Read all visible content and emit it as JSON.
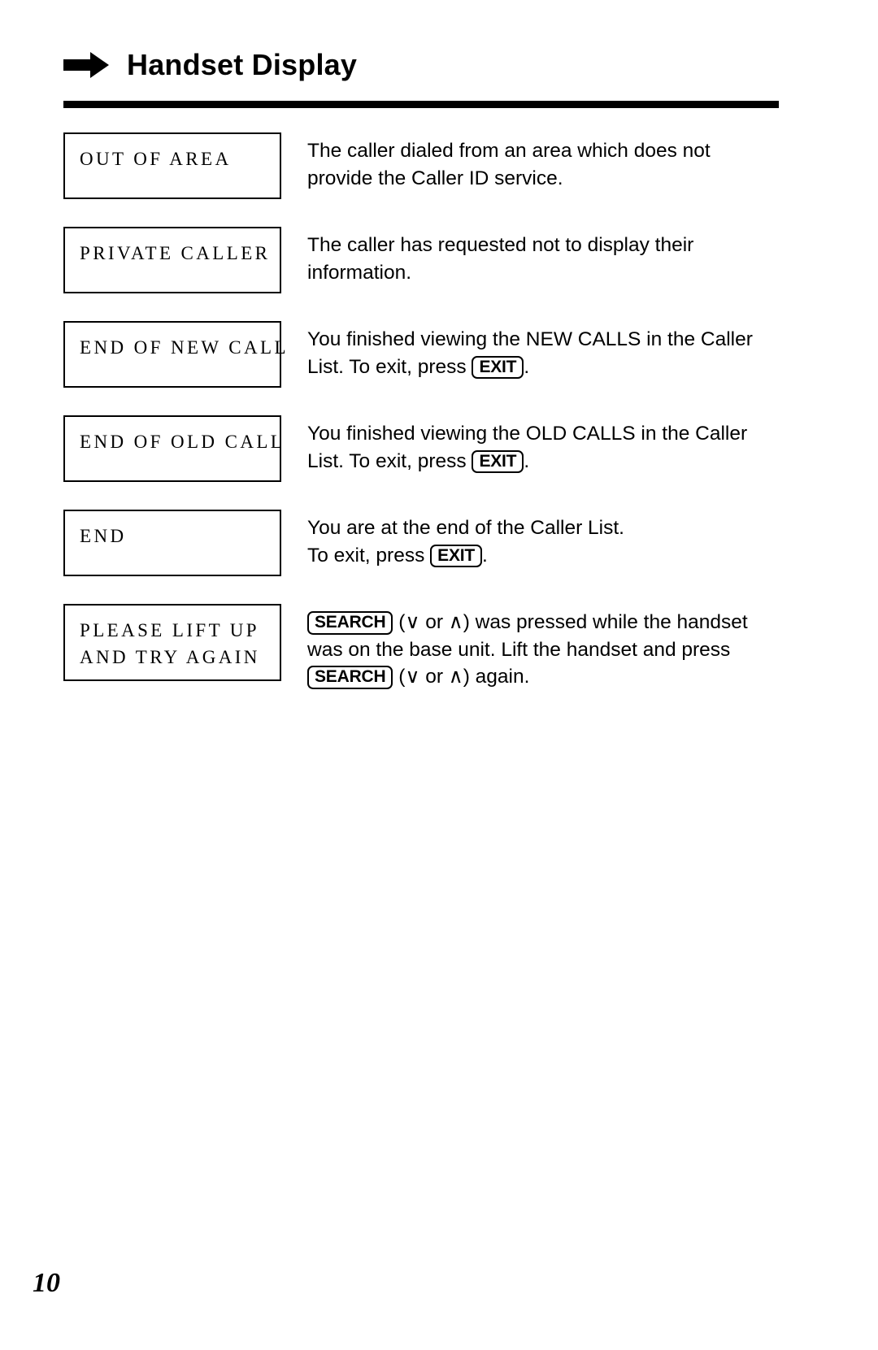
{
  "header": {
    "arrow_icon": "right-arrow-icon",
    "title": "Handset Display"
  },
  "rows": [
    {
      "display_lines": [
        "OUT OF AREA"
      ],
      "description_parts": [
        {
          "type": "text",
          "text": "The caller dialed from an area which does not provide the Caller ID service."
        }
      ]
    },
    {
      "display_lines": [
        "PRIVATE CALLER"
      ],
      "description_parts": [
        {
          "type": "text",
          "text": "The caller has requested not to display their information."
        }
      ]
    },
    {
      "display_lines": [
        "END OF NEW CALL"
      ],
      "description_parts": [
        {
          "type": "text",
          "text": "You finished viewing the NEW CALLS in the Caller List. To exit, press "
        },
        {
          "type": "key",
          "text": "EXIT"
        },
        {
          "type": "text",
          "text": "."
        }
      ]
    },
    {
      "display_lines": [
        "END OF OLD CALL"
      ],
      "description_parts": [
        {
          "type": "text",
          "text": "You finished viewing the OLD CALLS in the Caller List. To exit, press "
        },
        {
          "type": "key",
          "text": "EXIT"
        },
        {
          "type": "text",
          "text": "."
        }
      ]
    },
    {
      "display_lines": [
        "END"
      ],
      "description_parts": [
        {
          "type": "text",
          "text": "You are at the end of the Caller List."
        },
        {
          "type": "break"
        },
        {
          "type": "text",
          "text": "To exit, press "
        },
        {
          "type": "key",
          "text": "EXIT"
        },
        {
          "type": "text",
          "text": "."
        }
      ]
    },
    {
      "display_lines": [
        "PLEASE LIFT UP",
        "AND TRY AGAIN"
      ],
      "description_parts": [
        {
          "type": "key",
          "text": "SEARCH"
        },
        {
          "type": "text",
          "text": " (∨ or ∧) was pressed while the handset was on the base unit. Lift the handset and press "
        },
        {
          "type": "key",
          "text": "SEARCH"
        },
        {
          "type": "text",
          "text": " (∨ or ∧) again."
        }
      ]
    }
  ],
  "footer": {
    "page_number": "10"
  }
}
